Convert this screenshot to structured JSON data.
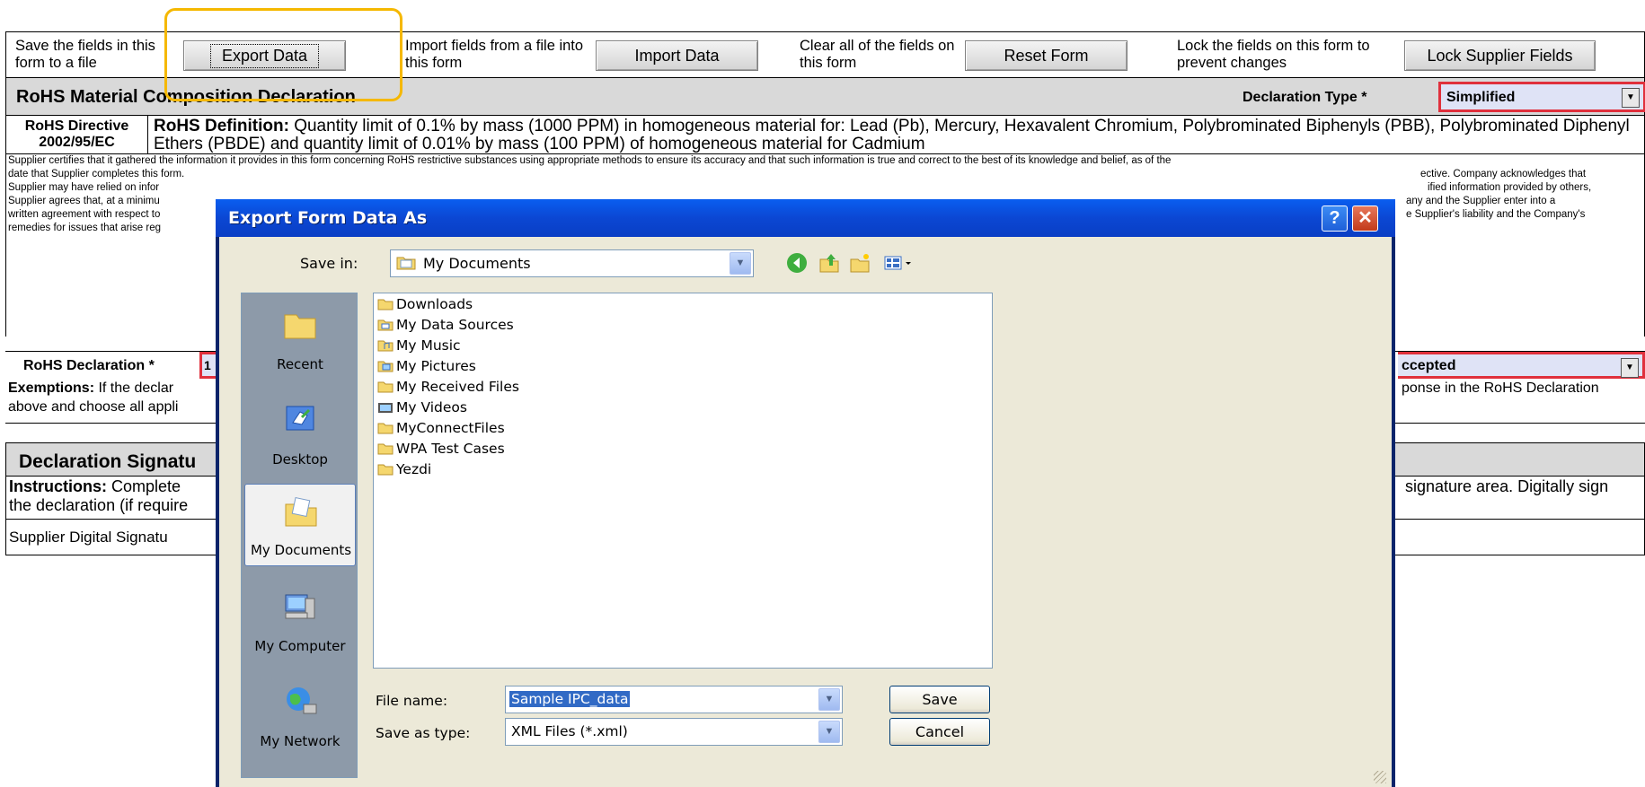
{
  "form": {
    "toolbar": {
      "export_desc": "Save the fields in this form to a file",
      "export_button": "Export Data",
      "import_desc": "Import fields from a file into this form",
      "import_button": "Import Data",
      "reset_desc": "Clear all of the fields on this form",
      "reset_button": "Reset Form",
      "lock_desc": "Lock the fields on this form to prevent changes",
      "lock_button": "Lock Supplier Fields"
    },
    "section_title": "RoHS Material Composition Declaration",
    "declaration_type_label": "Declaration Type *",
    "declaration_type_value": "Simplified",
    "directive_label": "RoHS Directive 2002/95/EC",
    "definition_bold": "RoHS Definition:",
    "definition_text": " Quantity limit of 0.1% by mass (1000 PPM) in homogeneous material for: Lead (Pb), Mercury, Hexavalent Chromium, Polybrominated Biphenyls (PBB), Polybrominated Diphenyl Ethers (PBDE) and quantity limit of 0.01% by mass (100 PPM) of homogeneous material for Cadmium",
    "legal_line1_left": "Supplier certifies that it gathered the information it provides in this form concerning RoHS restrictive substances  using appropriate methods to ensure its accuracy and that such information is true and correct to the best of its knowledge and belief, as of the",
    "legal_line2_left": "date that Supplier completes this form.",
    "legal_line2_right": "ective.  Company acknowledges that",
    "legal_line3_left": "Supplier may have relied on infor",
    "legal_line3_right": "ified information provided by others,",
    "legal_line4_left": "Supplier agrees that, at a minimu",
    "legal_line4_right": "any and the Supplier enter into a",
    "legal_line5_left": "written agreement with respect to",
    "legal_line5_right": "e Supplier's liability and the Company's",
    "legal_line6_left": "remedies for issues that arise reg",
    "rohs_declaration_label": "RoHS Declaration *",
    "rohs_declaration_left": "1",
    "rohs_declaration_right": "ccepted",
    "exemptions_bold": "Exemptions:",
    "exemptions_left1": " If the declar",
    "exemptions_left2": "above and choose all appli",
    "exemptions_right": "ponse in the RoHS Declaration",
    "signature_title": "Declaration Signatu",
    "instructions_bold": "Instructions:",
    "instructions_left1": " Complete",
    "instructions_left2": "the declaration (if require",
    "instructions_right": "signature area.  Digitally sign",
    "digital_signature_label": "Supplier Digital Signatu"
  },
  "dialog": {
    "title": "Export Form Data As",
    "help_glyph": "?",
    "close_glyph": "✕",
    "save_in_label": "Save in:",
    "save_in_value": "My Documents",
    "places": [
      {
        "label": "Recent"
      },
      {
        "label": "Desktop"
      },
      {
        "label": "My Documents"
      },
      {
        "label": "My Computer"
      },
      {
        "label": "My Network"
      }
    ],
    "files": [
      {
        "name": "Downloads",
        "icon": "folder-icon"
      },
      {
        "name": "My Data Sources",
        "icon": "data-sources-folder-icon"
      },
      {
        "name": "My Music",
        "icon": "music-folder-icon"
      },
      {
        "name": "My Pictures",
        "icon": "pictures-folder-icon"
      },
      {
        "name": "My Received Files",
        "icon": "folder-icon"
      },
      {
        "name": "My Videos",
        "icon": "videos-folder-icon"
      },
      {
        "name": "MyConnectFiles",
        "icon": "folder-icon"
      },
      {
        "name": "WPA Test Cases",
        "icon": "folder-icon"
      },
      {
        "name": "Yezdi",
        "icon": "folder-icon"
      }
    ],
    "file_name_label": "File name:",
    "file_name_value": "Sample IPC_data",
    "save_as_type_label": "Save as type:",
    "save_as_type_value": "XML Files (*.xml)",
    "save_button": "Save",
    "cancel_button": "Cancel"
  },
  "colors": {
    "highlight": "#f5b800",
    "required_field_border": "#e0303c",
    "dialog_title_bar": "#0b47d3"
  }
}
